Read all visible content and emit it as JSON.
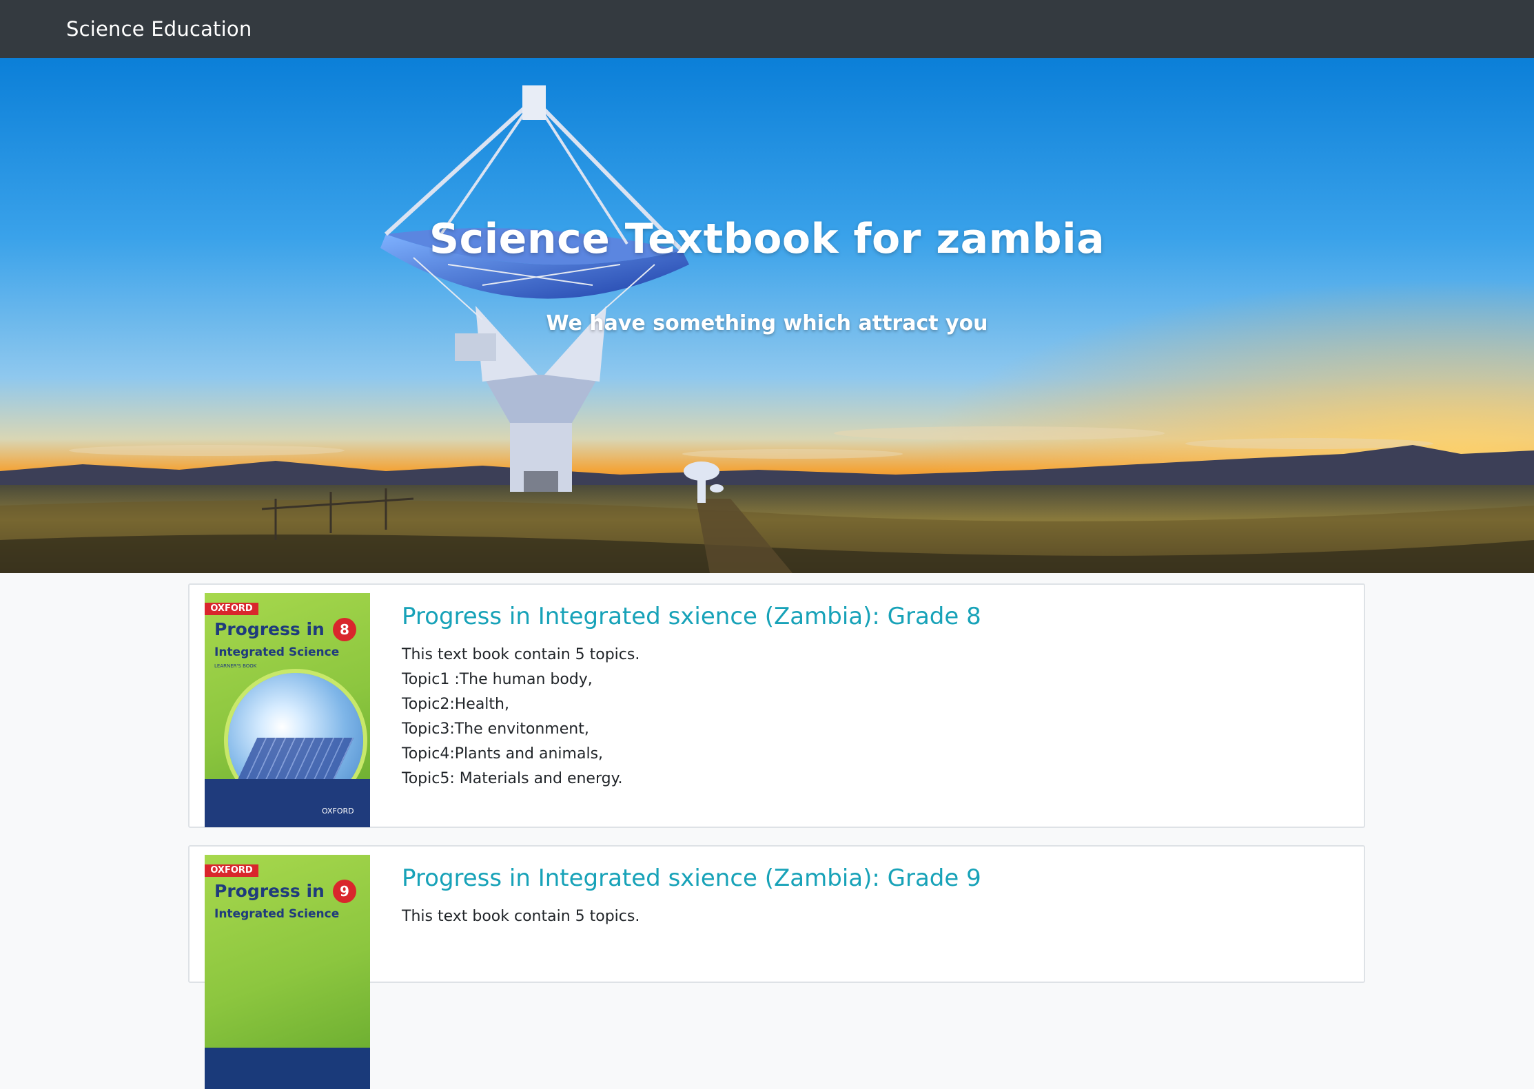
{
  "navbar": {
    "brand": "Science Education"
  },
  "hero": {
    "title": "Science Textbook for zambia",
    "subtitle": "We have something which attract you"
  },
  "books": [
    {
      "title": "Progress in Integrated sxience (Zambia): Grade 8",
      "cover": {
        "publisher": "OXFORD",
        "series": "Progress in",
        "subject": "Integrated Science",
        "label": "LEARNER'S BOOK",
        "grade": "8"
      },
      "lines": [
        "This text book contain 5 topics.",
        "Topic1 :The human body,",
        "Topic2:Health,",
        "Topic3:The envitonment,",
        "Topic4:Plants and animals,",
        "Topic5: Materials and energy."
      ]
    },
    {
      "title": "Progress in Integrated sxience (Zambia): Grade 9",
      "cover": {
        "publisher": "OXFORD",
        "series": "Progress in",
        "subject": "Integrated Science",
        "grade": "9"
      },
      "lines": [
        "This text book contain 5 topics."
      ]
    }
  ],
  "colors": {
    "navbar": "#343a40",
    "link": "#17a2b8",
    "page_bg": "#f8f9fa"
  }
}
